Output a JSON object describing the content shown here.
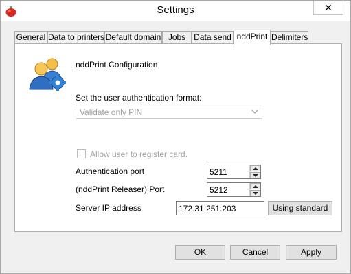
{
  "window": {
    "title": "Settings",
    "close_glyph": "✕",
    "app_icon": "tomato-app-icon"
  },
  "tabs": [
    {
      "label": "General"
    },
    {
      "label": "Data to printers"
    },
    {
      "label": "Default domain"
    },
    {
      "label": "Jobs"
    },
    {
      "label": "Data send"
    },
    {
      "label": "nddPrint",
      "active": true
    },
    {
      "label": "Delimiters"
    }
  ],
  "panel": {
    "icon": "users-gear-icon",
    "heading": "nddPrint Configuration",
    "auth_format_label": "Set the user authentication format:",
    "auth_format_value": "Validate only PIN",
    "register_card_label": "Allow user to register card.",
    "register_card_checked": false,
    "auth_port_label": "Authentication port",
    "auth_port_value": "5211",
    "releaser_port_label": "(nddPrint Releaser) Port",
    "releaser_port_value": "5212",
    "server_ip_label": "Server IP address",
    "server_ip_value": "172.31.251.203",
    "using_standard_label": "Using standard"
  },
  "footer": {
    "ok_label": "OK",
    "cancel_label": "Cancel",
    "apply_label": "Apply"
  },
  "colors": {
    "window_bg": "#f0f0f0",
    "panel_bg": "#ffffff",
    "disabled_text": "#a0a0a0",
    "button_bg": "#e1e1e1"
  }
}
